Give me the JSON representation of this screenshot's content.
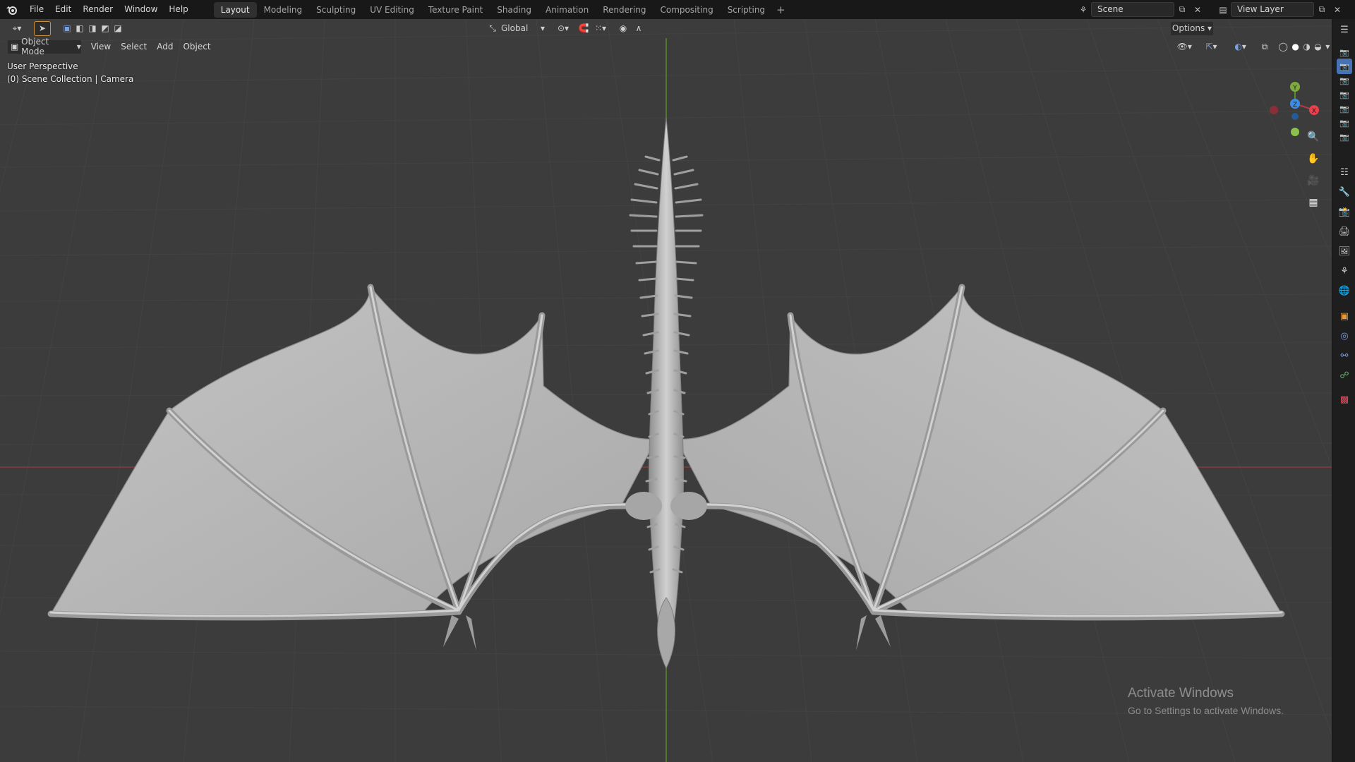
{
  "topbar": {
    "menus": [
      "File",
      "Edit",
      "Render",
      "Window",
      "Help"
    ],
    "workspaces": [
      "Layout",
      "Modeling",
      "Sculpting",
      "UV Editing",
      "Texture Paint",
      "Shading",
      "Animation",
      "Rendering",
      "Compositing",
      "Scripting"
    ],
    "active_workspace": "Layout",
    "add_tab": "+",
    "scene_name": "Scene",
    "view_layer": "View Layer"
  },
  "viewport_header": {
    "orientation": "Global",
    "options": "Options",
    "mode": "Object Mode",
    "menus": [
      "View",
      "Select",
      "Add",
      "Object"
    ]
  },
  "overlay": {
    "perspective": "User Perspective",
    "collection": "(0) Scene Collection | Camera"
  },
  "gizmo": {
    "y": "Y",
    "z": "Z",
    "x": "X",
    "colors": {
      "x": "#e8404f",
      "y": "#8bc34a",
      "z": "#3a8ee6"
    }
  },
  "watermark": {
    "title": "Activate Windows",
    "subtitle": "Go to Settings to activate Windows."
  },
  "colors": {
    "viewport_bg": "#393939",
    "grid": "#444444",
    "x_axis": "#8a3a3a",
    "y_axis": "#5b8a2a",
    "mesh": "#b7b7b7",
    "accent": "#4772b3"
  }
}
